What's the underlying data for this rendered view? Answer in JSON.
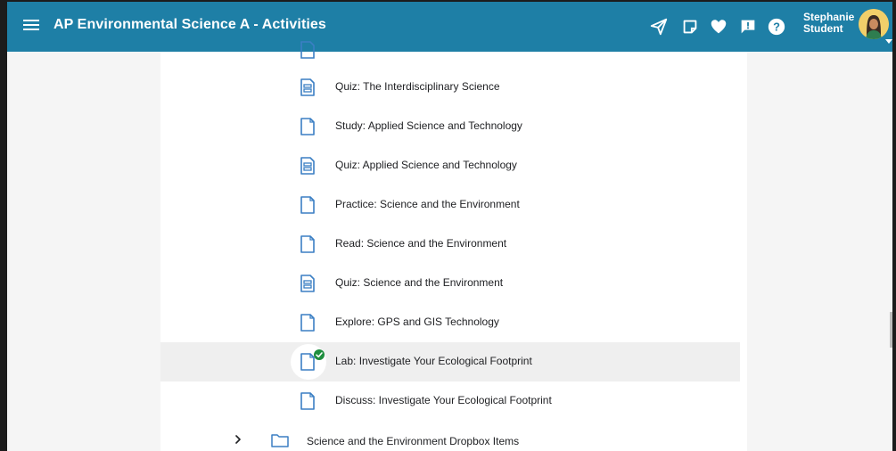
{
  "app": {
    "title": "AP Environmental Science A - Activities"
  },
  "toolbar_icons": [
    "send-icon",
    "sticky-note-icon",
    "heart-icon",
    "feedback-icon",
    "help-icon"
  ],
  "user": {
    "first_name": "Stephanie",
    "last_name": "Student"
  },
  "activities": [
    {
      "label": "Quiz: The Interdisciplinary Science",
      "icon": "quiz-icon"
    },
    {
      "label": "Study: Applied Science and Technology",
      "icon": "page-icon"
    },
    {
      "label": "Quiz: Applied Science and Technology",
      "icon": "quiz-icon"
    },
    {
      "label": "Practice: Science and the Environment",
      "icon": "page-icon"
    },
    {
      "label": "Read: Science and the Environment",
      "icon": "page-icon"
    },
    {
      "label": "Quiz: Science and the Environment",
      "icon": "quiz-icon"
    },
    {
      "label": "Explore: GPS and GIS Technology",
      "icon": "page-icon"
    },
    {
      "label": "Lab: Investigate Your Ecological Footprint",
      "icon": "page-icon",
      "completed": true,
      "selected": true
    },
    {
      "label": "Discuss: Investigate Your Ecological Footprint",
      "icon": "page-icon"
    }
  ],
  "folder": {
    "label": "Science and the Environment Dropbox Items",
    "expanded": false
  },
  "colors": {
    "header": "#1e7fa6",
    "icon_blue": "#3b7fc4",
    "complete_green": "#1e8e3e"
  }
}
